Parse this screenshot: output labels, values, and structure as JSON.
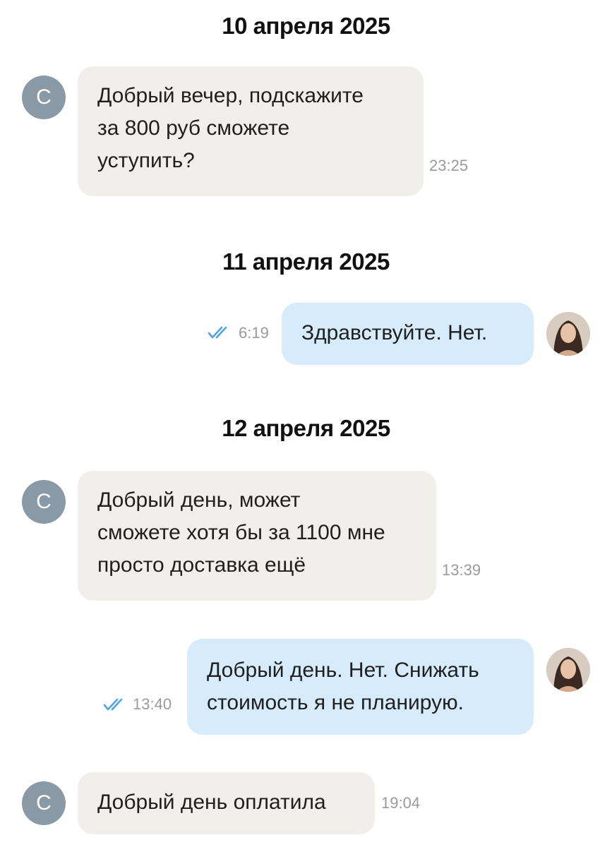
{
  "conversation": {
    "dates": [
      "10 апреля 2025",
      "11 апреля 2025",
      "12 апреля 2025"
    ],
    "messages": [
      {
        "sender": "С",
        "lines": [
          "Добрый вечер, подскажите",
          "за 800  руб сможете",
          "уступить?"
        ],
        "time": "23:25"
      },
      {
        "lines": [
          "Здравствуйте. Нет."
        ],
        "time": "6:19"
      },
      {
        "sender": "С",
        "lines": [
          "Добрый день, может",
          "сможете хотя бы за 1100 мне",
          "просто доставка ещё"
        ],
        "time": "13:39"
      },
      {
        "lines": [
          "Добрый день. Нет. Снижать",
          "стоимость я не планирую."
        ],
        "time": "13:40"
      },
      {
        "sender": "С",
        "lines": [
          "Добрый день оплатила"
        ],
        "time": "19:04"
      }
    ]
  },
  "colors": {
    "incoming_bubble": "#f1efeb",
    "outgoing_bubble": "#d6ebfb",
    "avatar_bg": "#8a99a6",
    "read_check": "#4fa3e6"
  }
}
